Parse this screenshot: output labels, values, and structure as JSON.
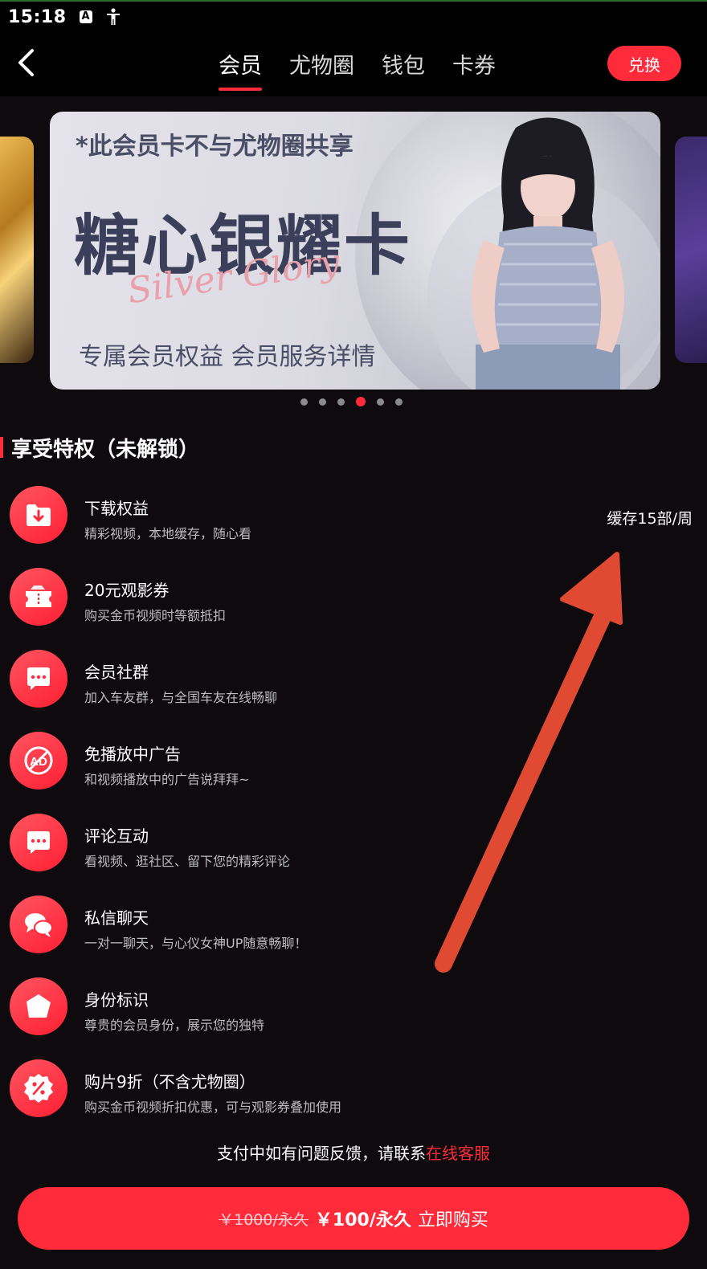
{
  "status_bar": {
    "time": "15:18",
    "icons": [
      "a-box-icon",
      "accessibility-icon"
    ]
  },
  "nav": {
    "back_icon": "chevron-left-icon",
    "tabs": [
      {
        "label": "会员",
        "active": true
      },
      {
        "label": "尤物圈",
        "active": false
      },
      {
        "label": "钱包",
        "active": false
      },
      {
        "label": "卡券",
        "active": false
      }
    ],
    "redeem_label": "兑换"
  },
  "banner": {
    "note": "*此会员卡不与尤物圈共享",
    "title": "糖心银耀卡",
    "script_text": "Silver Glory",
    "subtitle": "专属会员权益  会员服务详情",
    "slide_count": 6,
    "active_slide": 4
  },
  "section": {
    "title": "享受特权（未解锁）"
  },
  "perks": [
    {
      "title": "下载权益",
      "desc": "精彩视频，本地缓存，随心看",
      "extra": "缓存15部/周",
      "icon": "download-folder-icon"
    },
    {
      "title": "20元观影券",
      "desc": "购买金币视频时等额抵扣",
      "extra": "",
      "icon": "ticket-icon"
    },
    {
      "title": "会员社群",
      "desc": "加入车友群，与全国车友在线畅聊",
      "extra": "",
      "icon": "chat-bubble-icon"
    },
    {
      "title": "免播放中广告",
      "desc": "和视频播放中的广告说拜拜~",
      "extra": "",
      "icon": "no-ad-icon"
    },
    {
      "title": "评论互动",
      "desc": "看视频、逛社区、留下您的精彩评论",
      "extra": "",
      "icon": "comment-icon"
    },
    {
      "title": "私信聊天",
      "desc": "一对一聊天，与心仪女神UP随意畅聊！",
      "extra": "",
      "icon": "private-chat-icon"
    },
    {
      "title": "身份标识",
      "desc": "尊贵的会员身份，展示您的独特",
      "extra": "",
      "icon": "identity-badge-icon"
    },
    {
      "title": "购片9折（不含尤物圈）",
      "desc": "购买金币视频折扣优惠，可与观影券叠加使用",
      "extra": "",
      "icon": "discount-icon"
    }
  ],
  "support": {
    "text": "支付中如有问题反馈，请联系",
    "link": "在线客服"
  },
  "buy": {
    "old_price": "￥1000/永久",
    "new_price": "￥100/永久",
    "action": "立即购买"
  },
  "colors": {
    "accent": "#ff2a3a",
    "background": "#0e0a0e",
    "annotation_arrow": "#e04a33"
  }
}
